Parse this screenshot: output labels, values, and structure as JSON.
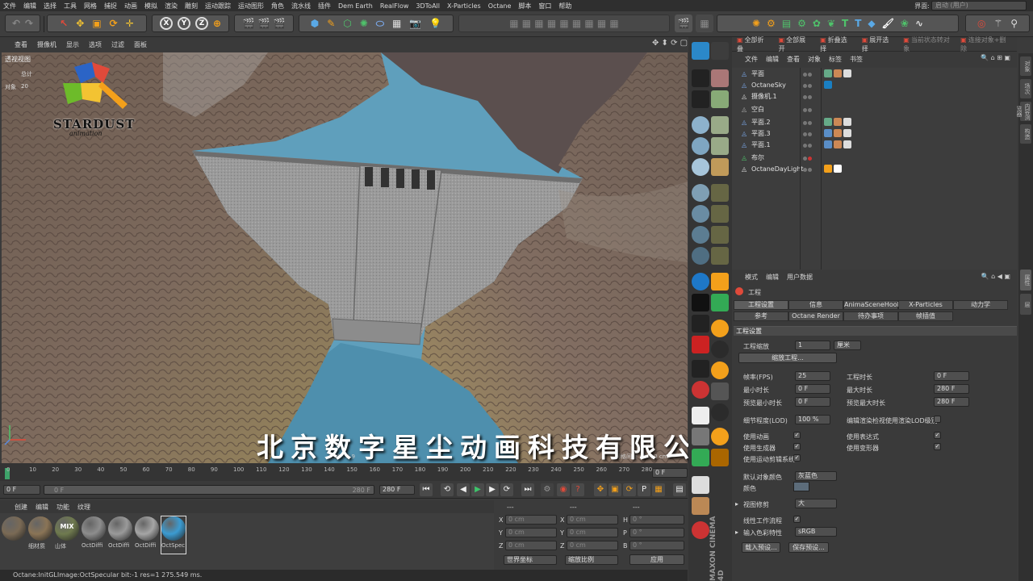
{
  "menu": [
    "文件",
    "编辑",
    "选择",
    "工具",
    "网格",
    "捕捉",
    "动画",
    "模拟",
    "渲染",
    "雕刻",
    "运动跟踪",
    "运动图形",
    "角色",
    "流水线",
    "插件",
    "Dem Earth",
    "RealFlow",
    "3DToAll",
    "X-Particles",
    "Octane",
    "脚本",
    "窗口",
    "帮助"
  ],
  "layout": {
    "label": "界面:",
    "value": "启动 (用户)"
  },
  "toolbar": {
    "x": "X",
    "y": "Y",
    "z": "Z"
  },
  "viewport": {
    "menu": [
      "查看",
      "摄像机",
      "显示",
      "选项",
      "过滤",
      "面板"
    ],
    "label": "透视视图",
    "stats_total": "总计",
    "stats_objects_label": "对象",
    "stats_objects_value": "20",
    "logo_text": "STARDUST",
    "logo_sub": "animation",
    "grid_label": "网格间距 : 1000 cm",
    "frame_label": "帧速 : 3.9",
    "watermark": "北京数字星尘动画科技有限公司"
  },
  "object_manager": {
    "top_buttons": [
      "全部折叠",
      "全部展开",
      "折叠选择",
      "展开选择",
      "当前状态转对象",
      "连接对象+删除"
    ],
    "menu": [
      "文件",
      "编辑",
      "查看",
      "对象",
      "标签",
      "书签"
    ],
    "objects": [
      {
        "name": "平面"
      },
      {
        "name": "OctaneSky"
      },
      {
        "name": "摄像机.1"
      },
      {
        "name": "空白"
      },
      {
        "name": "平面.2"
      },
      {
        "name": "平面.3"
      },
      {
        "name": "平面.1"
      },
      {
        "name": "布尔"
      },
      {
        "name": "OctaneDayLight"
      }
    ]
  },
  "side_tabs": [
    "对象",
    "场次",
    "内容浏览器",
    "构造"
  ],
  "side_tabs_bottom": [
    "属性",
    "层"
  ],
  "attributes": {
    "menu": [
      "模式",
      "编辑",
      "用户数据"
    ],
    "title": "工程",
    "tabs_row1": [
      "工程设置",
      "信息",
      "AnimaSceneHook",
      "X-Particles",
      "动力学"
    ],
    "tabs_row2": [
      "参考",
      "Octane Render",
      "待办事项",
      "帧插值"
    ],
    "section_project": "工程设置",
    "scale_label": "工程缩放",
    "scale_value": "1",
    "scale_unit": "厘米",
    "scale_button": "缩放工程...",
    "fps_label": "帧率(FPS)",
    "fps_value": "25",
    "project_time_label": "工程时长",
    "project_time_value": "0 F",
    "min_time_label": "最小时长",
    "min_time_value": "0 F",
    "max_time_label": "最大时长",
    "max_time_value": "280 F",
    "preview_min_label": "预览最小时长",
    "preview_min_value": "0 F",
    "preview_max_label": "预览最大时长",
    "preview_max_value": "280 F",
    "lod_label": "细节程度(LOD)",
    "lod_value": "100 %",
    "lod_render_label": "编辑渲染检视使用渲染LOD级别",
    "use_anim_label": "使用动画",
    "use_expr_label": "使用表达式",
    "use_gen_label": "使用生成器",
    "use_deform_label": "使用变形器",
    "use_motion_label": "使用运动剪辑系统",
    "default_color_label": "默认对象颜色",
    "default_color_value": "灰蓝色",
    "color_label": "颜色",
    "view_clip_label": "视图修剪",
    "view_clip_value": "大",
    "linear_label": "线性工作流程",
    "input_color_label": "输入色彩特性",
    "input_color_value": "sRGB",
    "load_preset": "载入预设...",
    "save_preset": "保存预设..."
  },
  "timeline": {
    "ticks": [
      "0",
      "10",
      "20",
      "30",
      "40",
      "50",
      "60",
      "70",
      "80",
      "90",
      "100",
      "110",
      "120",
      "130",
      "140",
      "150",
      "160",
      "170",
      "180",
      "190",
      "200",
      "210",
      "220",
      "230",
      "240",
      "250",
      "260",
      "270",
      "280"
    ],
    "current_frame": "0 F"
  },
  "transport": {
    "start": "0 F",
    "range_start": "0 F",
    "range_end": "280 F",
    "end": "280 F"
  },
  "material_manager": {
    "menu": [
      "创建",
      "编辑",
      "功能",
      "纹理"
    ],
    "materials": [
      {
        "name": "",
        "color": "#7a6a55"
      },
      {
        "name": "细材质",
        "color": "#8a7456"
      },
      {
        "name": "山体",
        "color": "#6f7a4f",
        "badge": "MIX"
      },
      {
        "name": "OctDiffi",
        "color": "#8d8d8d"
      },
      {
        "name": "OctDiffi",
        "color": "#9a9a9a"
      },
      {
        "name": "OctDiffi",
        "color": "#a5a5a5"
      },
      {
        "name": "OctSpec",
        "color": "#3b9bd1"
      }
    ]
  },
  "coordinates": {
    "header": [
      "---",
      "---",
      "---"
    ],
    "rows": [
      {
        "axis": "X",
        "pos": "0 cm",
        "axis2": "X",
        "size": "0 cm",
        "axis3": "H",
        "rot": "0 °"
      },
      {
        "axis": "Y",
        "pos": "0 cm",
        "axis2": "Y",
        "size": "0 cm",
        "axis3": "P",
        "rot": "0 °"
      },
      {
        "axis": "Z",
        "pos": "0 cm",
        "axis2": "Z",
        "size": "0 cm",
        "axis3": "B",
        "rot": "0 °"
      }
    ],
    "space": "世界坐标",
    "mode": "缩放比例",
    "apply": "应用"
  },
  "brand": "MAXON CINEMA 4D",
  "status": "Octane:InitGLImage:OctSpecular  bit:-1 res=1  275.549 ms.",
  "colors": {
    "sky": "#5f9fbc",
    "accent": "#f3a01b",
    "panel": "#3a3a3a"
  }
}
